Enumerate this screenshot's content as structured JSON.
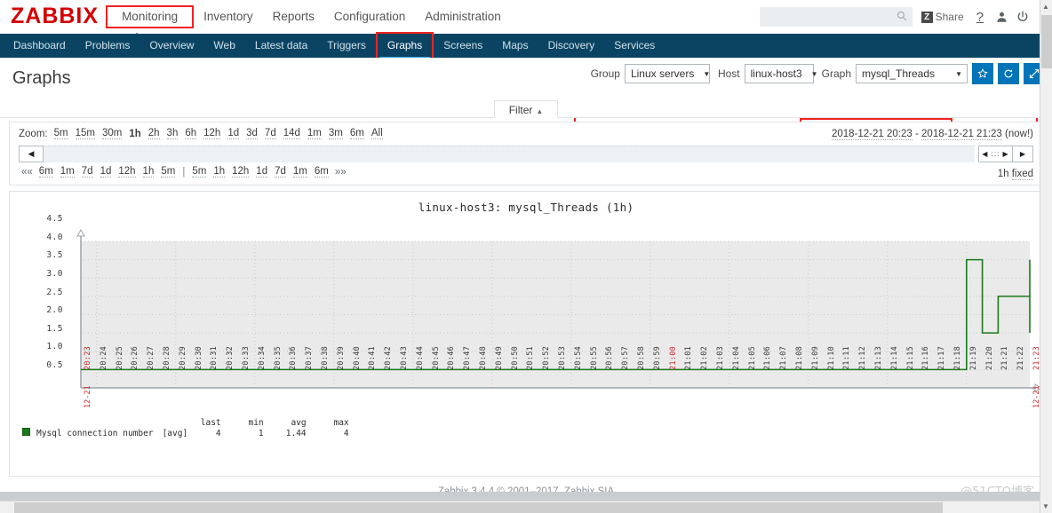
{
  "app": {
    "logo_text": "ZABBIX",
    "footer": "Zabbix 3.4.4 © 2001–2017, Zabbix SIA",
    "watermark": "@51CTO博客"
  },
  "header": {
    "menu": [
      {
        "label": "Monitoring",
        "selected": true
      },
      {
        "label": "Inventory",
        "selected": false
      },
      {
        "label": "Reports",
        "selected": false
      },
      {
        "label": "Configuration",
        "selected": false
      },
      {
        "label": "Administration",
        "selected": false
      }
    ],
    "search": {
      "value": "",
      "placeholder": ""
    },
    "share_label": "Share",
    "share_badge": "Z",
    "help_label": "?",
    "user_label": "",
    "signout_label": ""
  },
  "submenu": {
    "items": [
      {
        "label": "Dashboard",
        "active": false
      },
      {
        "label": "Problems",
        "active": false
      },
      {
        "label": "Overview",
        "active": false
      },
      {
        "label": "Web",
        "active": false
      },
      {
        "label": "Latest data",
        "active": false
      },
      {
        "label": "Triggers",
        "active": false
      },
      {
        "label": "Graphs",
        "active": true
      },
      {
        "label": "Screens",
        "active": false
      },
      {
        "label": "Maps",
        "active": false
      },
      {
        "label": "Discovery",
        "active": false
      },
      {
        "label": "Services",
        "active": false
      }
    ]
  },
  "page": {
    "title": "Graphs"
  },
  "filter": {
    "group_label": "Group",
    "group_value": "Linux servers",
    "host_label": "Host",
    "host_value": "linux-host3",
    "graph_label": "Graph",
    "graph_value": "mysql_Threads",
    "favorite_icon": "star-icon",
    "refresh_icon": "refresh-icon",
    "expand_icon": "expand-icon",
    "tab_label": "Filter"
  },
  "time_selector": {
    "zoom_label": "Zoom:",
    "zoom_options": [
      "5m",
      "15m",
      "30m",
      "1h",
      "2h",
      "3h",
      "6h",
      "12h",
      "1d",
      "3d",
      "7d",
      "14d",
      "1m",
      "3m",
      "6m",
      "All"
    ],
    "zoom_selected": "1h",
    "range_from": "2018-12-21 20:23",
    "range_dash": "-",
    "range_to": "2018-12-21 21:23",
    "range_now": "(now!)",
    "back_arrow": "◀",
    "nav_scroll": "◀ ::: ▶",
    "nav_forward": "▶",
    "nav_left_chevrons": "««",
    "nav_right_chevrons": "»»",
    "left_steps": [
      "6m",
      "1m",
      "7d",
      "1d",
      "12h",
      "1h",
      "5m"
    ],
    "separator": "|",
    "right_steps": [
      "5m",
      "1h",
      "12h",
      "1d",
      "7d",
      "1m",
      "6m"
    ],
    "period_label": "1h",
    "fixed_label": "fixed"
  },
  "chart_data": {
    "type": "line",
    "title": "linux-host3: mysql_Threads (1h)",
    "xlabel": "",
    "ylabel": "",
    "ylim": [
      0.5,
      4.5
    ],
    "yticks": [
      "4.5",
      "4.0",
      "3.5",
      "3.0",
      "2.5",
      "2.0",
      "1.5",
      "1.0",
      "0.5"
    ],
    "grid": true,
    "legend_position": "bottom-left",
    "date_start": "12-21",
    "date_end": "12-21",
    "x": [
      "20:23",
      "20:24",
      "20:25",
      "20:26",
      "20:27",
      "20:28",
      "20:29",
      "20:30",
      "20:31",
      "20:32",
      "20:33",
      "20:34",
      "20:35",
      "20:36",
      "20:37",
      "20:38",
      "20:39",
      "20:40",
      "20:41",
      "20:42",
      "20:43",
      "20:44",
      "20:45",
      "20:46",
      "20:47",
      "20:48",
      "20:49",
      "20:50",
      "20:51",
      "20:52",
      "20:53",
      "20:54",
      "20:55",
      "20:56",
      "20:57",
      "20:58",
      "20:59",
      "21:00",
      "21:01",
      "21:02",
      "21:03",
      "21:04",
      "21:05",
      "21:06",
      "21:07",
      "21:08",
      "21:09",
      "21:10",
      "21:11",
      "21:12",
      "21:13",
      "21:14",
      "21:15",
      "21:16",
      "21:17",
      "21:18",
      "21:19",
      "21:20",
      "21:21",
      "21:22",
      "21:23"
    ],
    "x_red_ticks": [
      "20:23",
      "21:00",
      "21:23"
    ],
    "series": [
      {
        "name": "Mysql connection number",
        "aggregate": "[avg]",
        "color": "#1a7a1a",
        "values": [
          1,
          1,
          1,
          1,
          1,
          1,
          1,
          1,
          1,
          1,
          1,
          1,
          1,
          1,
          1,
          1,
          1,
          1,
          1,
          1,
          1,
          1,
          1,
          1,
          1,
          1,
          1,
          1,
          1,
          1,
          1,
          1,
          1,
          1,
          1,
          1,
          1,
          1,
          1,
          1,
          1,
          1,
          1,
          1,
          1,
          1,
          1,
          1,
          1,
          1,
          1,
          1,
          1,
          1,
          1,
          1,
          4,
          2,
          3,
          3,
          2,
          2,
          2,
          4
        ],
        "last": "4",
        "min": "1",
        "avg": "1.44",
        "max": "4"
      }
    ],
    "legend_headers": [
      "last",
      "min",
      "avg",
      "max"
    ]
  }
}
